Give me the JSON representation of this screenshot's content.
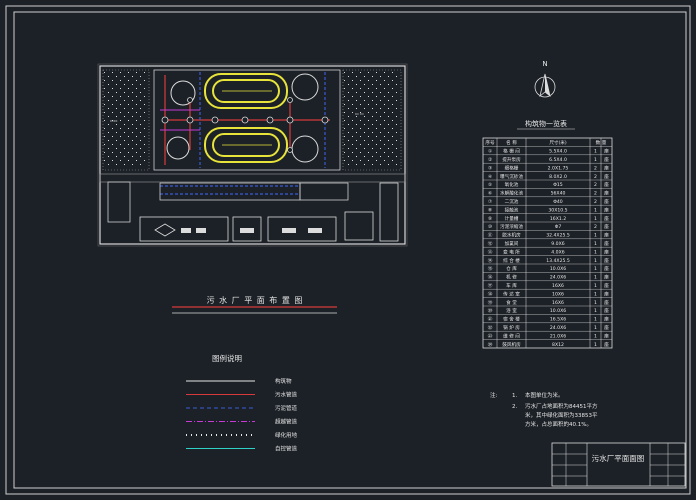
{
  "north_label": "N",
  "plan_title": "污 水 厂 平 面 布 置 图",
  "legend": {
    "title": "图例说明",
    "items": [
      {
        "label": "构筑物",
        "color": "#e6e6e6"
      },
      {
        "label": "污水管道",
        "color": "#d63a3a"
      },
      {
        "label": "污泥管道",
        "color": "#3a5ad6"
      },
      {
        "label": "超越管道",
        "color": "#c83ad6"
      },
      {
        "label": "绿化用地",
        "color": "#e6e6e6"
      },
      {
        "label": "自控管道",
        "color": "#2fd0c8"
      }
    ]
  },
  "table": {
    "title": "构筑物一览表",
    "headers": [
      "序号",
      "名 称",
      "尺寸(米)",
      "数 量"
    ],
    "rows": [
      [
        "①",
        "格 栅 间",
        "5.5X4.0",
        "1 座"
      ],
      [
        "②",
        "提升泵房",
        "6.5X4.0",
        "1 座"
      ],
      [
        "③",
        "细格栅",
        "2.0X1.75",
        "2 座"
      ],
      [
        "④",
        "曝气沉砂池",
        "8.0X2.0",
        "2 座"
      ],
      [
        "⑤",
        "氧化池",
        "Φ15",
        "2 座"
      ],
      [
        "⑥",
        "水解酸化池",
        "56X40",
        "2 座"
      ],
      [
        "⑦",
        "二沉池",
        "Φ40",
        "2 座"
      ],
      [
        "⑧",
        "接触池",
        "30X10.5",
        "1 座"
      ],
      [
        "⑨",
        "计量槽",
        "16X1.2",
        "1 座"
      ],
      [
        "⑩",
        "污泥浓缩池",
        "Φ7",
        "2 座"
      ],
      [
        "⑪",
        "脱水机房",
        "32.4X25.5",
        "1 座"
      ],
      [
        "⑫",
        "加氯间",
        "9.0X6",
        "1 座"
      ],
      [
        "⑬",
        "变 电 所",
        "4.0X6",
        "1 座"
      ],
      [
        "⑭",
        "综 合 楼",
        "13.4X25.5",
        "1 座"
      ],
      [
        "⑮",
        "仓 库",
        "10.0X6",
        "1 座"
      ],
      [
        "⑯",
        "机 修",
        "24.0X6",
        "1 座"
      ],
      [
        "⑰",
        "车 库",
        "16X6",
        "1 座"
      ],
      [
        "⑱",
        "传 达 室",
        "10X6",
        "1 座"
      ],
      [
        "⑲",
        "食 堂",
        "16X6",
        "1 座"
      ],
      [
        "⑳",
        "浴 室",
        "10.0X6",
        "1 座"
      ],
      [
        "㉑",
        "宿 舍 楼",
        "16.5X6",
        "1 座"
      ],
      [
        "㉒",
        "锅 炉 房",
        "24.0X6",
        "1 座"
      ],
      [
        "㉓",
        "维 修 间",
        "21.0X6",
        "1 座"
      ],
      [
        "㉔",
        "鼓风机房",
        "8X12",
        "1 座"
      ]
    ]
  },
  "notes": {
    "label": "注:",
    "items": [
      {
        "num": "1.",
        "lines": [
          "本图单位为米。"
        ]
      },
      {
        "num": "2.",
        "lines": [
          "污水厂占地面积为84451平方",
          "米，其中绿化面积为33853平",
          "方米，占总面积的40.1%。"
        ]
      }
    ]
  },
  "title_block": {
    "title": "污水厂平面面图"
  }
}
